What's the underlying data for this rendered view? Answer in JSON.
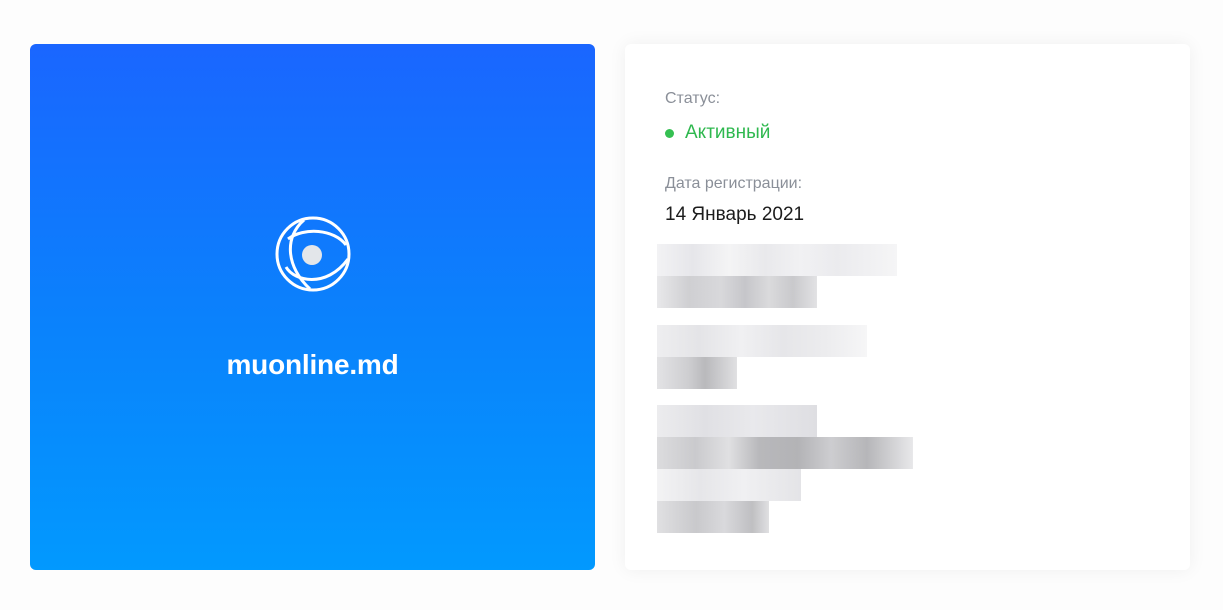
{
  "brand": {
    "icon": "globe-sphere-icon",
    "name": "muonline.md",
    "gradient_top": "#1a66ff",
    "gradient_bottom": "#0299fe"
  },
  "info": {
    "status_label": "Статус:",
    "status_value": "Активный",
    "status_color": "#2fb84f",
    "registration_label": "Дата регистрации:",
    "registration_value": "14 Январь 2021"
  }
}
